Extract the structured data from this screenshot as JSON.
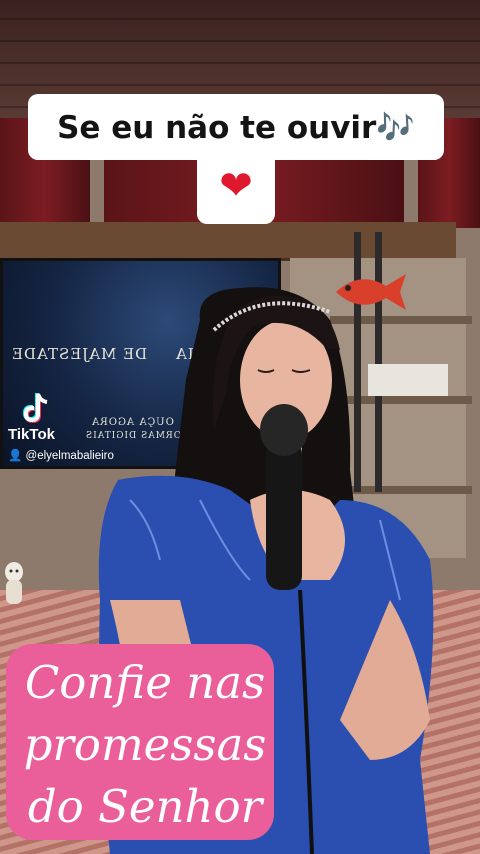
{
  "caption": {
    "line1": "Se eu não te ouvir🎶",
    "emoji": "❤"
  },
  "tv": {
    "text_left": "DE MAJESTADE",
    "text_right": "É CHEIA",
    "text_small1": "OUÇA AGORA",
    "text_small2": "NAS PLATAFORMAS DIGITAIS"
  },
  "watermark": {
    "brand": "TikTok",
    "handle": "@elyelmabalieiro"
  },
  "promo": {
    "line1": "Confie nas",
    "line2": "promessas",
    "line3": "do Senhor"
  },
  "colors": {
    "promo_pink": "#ea5f9a",
    "dress_blue": "#2a4fb0",
    "heart_red": "#e0182d"
  }
}
